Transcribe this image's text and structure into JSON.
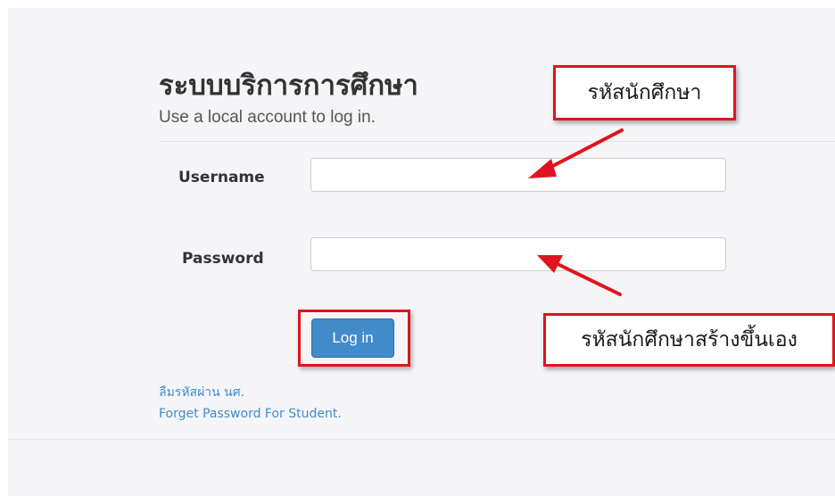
{
  "login": {
    "title": "ระบบบริการการศึกษา",
    "subtitle": "Use a local account to log in.",
    "username_label": "Username",
    "username_value": "",
    "password_label": "Password",
    "password_value": "",
    "login_button": "Log in",
    "forgot_link_thai": "ลืมรหัสผ่าน นศ.",
    "forgot_link_english": "Forget Password For Student."
  },
  "annotations": {
    "username_callout": "รหัสนักศึกษา",
    "password_callout": "รหัสนักศึกษาสร้างขึ้นเอง"
  },
  "colors": {
    "button_bg": "#428bca",
    "link": "#428bca",
    "annotation_red": "#e0141e",
    "panel_bg": "#f5f5f7"
  }
}
